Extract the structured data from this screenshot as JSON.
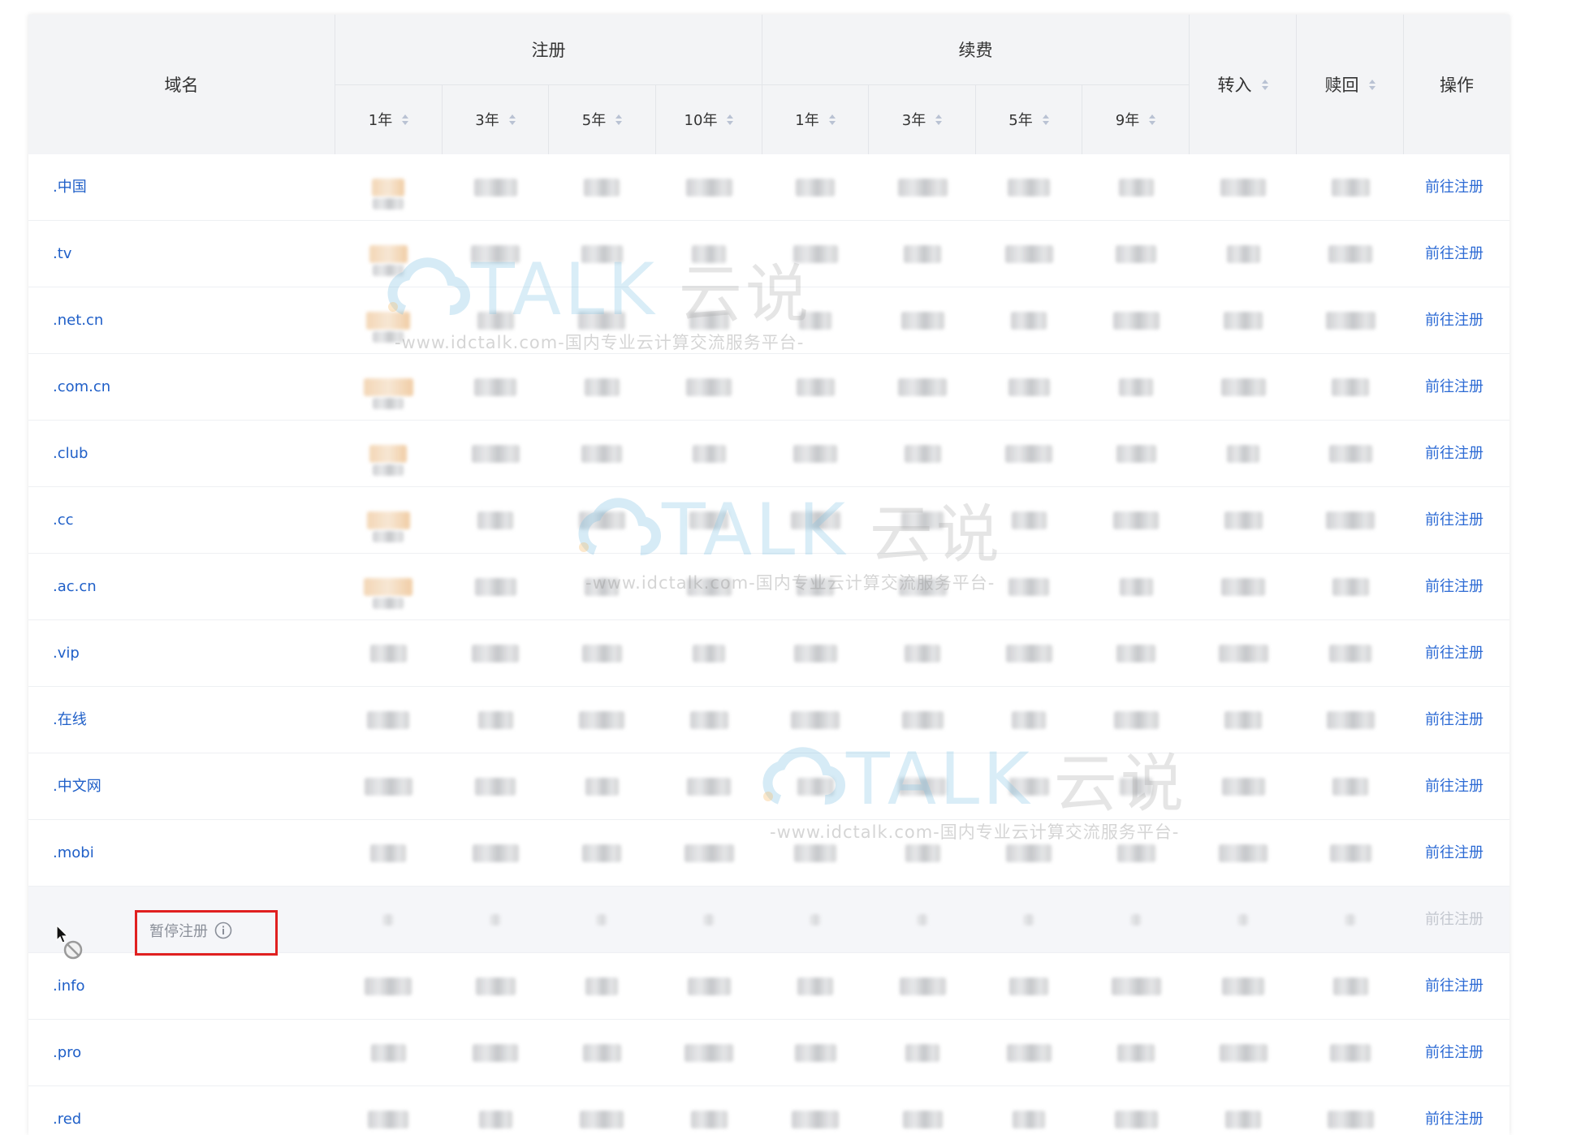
{
  "header": {
    "domain_col": "域名",
    "register_group": "注册",
    "renew_group": "续费",
    "transfer_col": "转入",
    "redeem_col": "赎回",
    "action_col": "操作",
    "register_years": [
      "1年",
      "3年",
      "5年",
      "10年"
    ],
    "renew_years": [
      "1年",
      "3年",
      "5年",
      "9年"
    ]
  },
  "rows": [
    {
      "domain": ".中国",
      "action": "前往注册"
    },
    {
      "domain": ".tv",
      "action": "前往注册"
    },
    {
      "domain": ".net.cn",
      "action": "前往注册"
    },
    {
      "domain": ".com.cn",
      "action": "前往注册"
    },
    {
      "domain": ".club",
      "action": "前往注册"
    },
    {
      "domain": ".cc",
      "action": "前往注册"
    },
    {
      "domain": ".ac.cn",
      "action": "前往注册"
    },
    {
      "domain": ".vip",
      "action": "前往注册"
    },
    {
      "domain": ".在线",
      "action": "前往注册"
    },
    {
      "domain": ".中文网",
      "action": "前往注册"
    },
    {
      "domain": ".mobi",
      "action": "前往注册"
    },
    {
      "domain": "",
      "status": "暂停注册",
      "action": "前往注册"
    },
    {
      "domain": ".info",
      "action": "前往注册"
    },
    {
      "domain": ".pro",
      "action": "前往注册"
    },
    {
      "domain": ".red",
      "action": "前往注册"
    }
  ],
  "watermark": {
    "logo": "TALK",
    "logo_cn": "云说",
    "tagline": "-www.idctalk.com-国内专业云计算交流服务平台-"
  },
  "colors": {
    "link": "#1f5fc8",
    "header_bg": "#f3f4f6",
    "highlight_box": "#e02020",
    "suspended_text": "#8a8f99"
  },
  "icons": {
    "sort": "sort-icon",
    "info": "info-icon",
    "cursor": "not-allowed-cursor-icon"
  }
}
